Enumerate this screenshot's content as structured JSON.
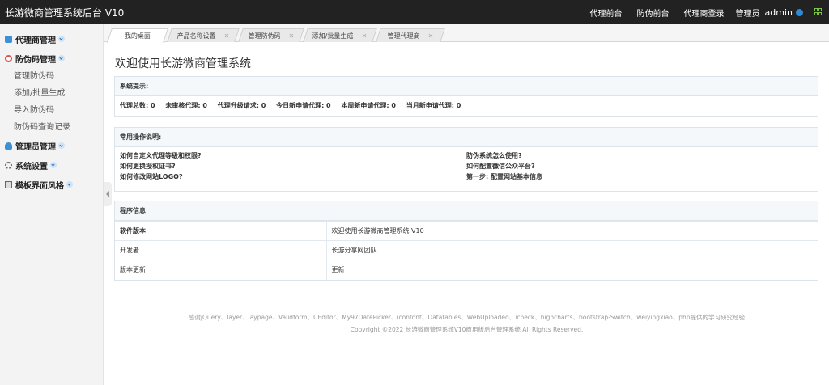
{
  "app": {
    "title": "长游微商管理系统后台 V10"
  },
  "topnav": {
    "links": [
      "代理前台",
      "防伪前台",
      "代理商登录"
    ],
    "role": "管理员",
    "user": "admin"
  },
  "sidebar": {
    "groups": [
      {
        "label": "代理商管理",
        "icon": "dashboard-icon"
      },
      {
        "label": "防伪码管理",
        "icon": "target-icon",
        "items": [
          "管理防伪码",
          "添加/批量生成",
          "导入防伪码",
          "防伪码查询记录"
        ]
      },
      {
        "label": "管理员管理",
        "icon": "user-icon"
      },
      {
        "label": "系统设置",
        "icon": "gear-icon"
      },
      {
        "label": "模板界面风格",
        "icon": "layout-icon"
      }
    ]
  },
  "tabs": [
    {
      "label": "我的桌面",
      "active": true
    },
    {
      "label": "产品名称设置"
    },
    {
      "label": "管理防伪码"
    },
    {
      "label": "添加/批量生成"
    },
    {
      "label": "管理代理商"
    }
  ],
  "main": {
    "welcome": "欢迎使用长游微商管理系统",
    "notice": {
      "title": "系统提示:",
      "stats": [
        "代理总数: 0",
        "未审核代理: 0",
        "代理升级请求: 0",
        "今日新申请代理: 0",
        "本周新申请代理: 0",
        "当月新申请代理: 0"
      ]
    },
    "help": {
      "title": "常用操作说明:",
      "left": [
        "如何自定义代理等级和权限?",
        "如何更换授权证书?",
        "如何修改网站LOGO?"
      ],
      "right": [
        "防伪系统怎么使用?",
        "如何配置微信公众平台?",
        "第一步: 配置网站基本信息"
      ]
    },
    "program": {
      "title": "程序信息",
      "rows": [
        {
          "key": "软件版本",
          "value": "欢迎使用长游微商管理系统 V10"
        },
        {
          "key": "开发者",
          "value": "长游分享网团队"
        },
        {
          "key": "版本更新",
          "value": "更新"
        }
      ]
    }
  },
  "footer": {
    "thanks": "感谢jQuery、layer、laypage、Validform、UEditor、My97DatePicker、iconfont、Datatables、WebUploaded、icheck、highcharts、bootstrap-Switch、weiyingxiao、php提供的学习研究经验",
    "copyright": "Copyright ©2022 长游微商管理系统V10商用版后台管理系统 All Rights Reserved."
  },
  "colors": {
    "topbar": "#222222",
    "accent": "#2a8bd8",
    "sidebar": "#f3f3f3"
  }
}
